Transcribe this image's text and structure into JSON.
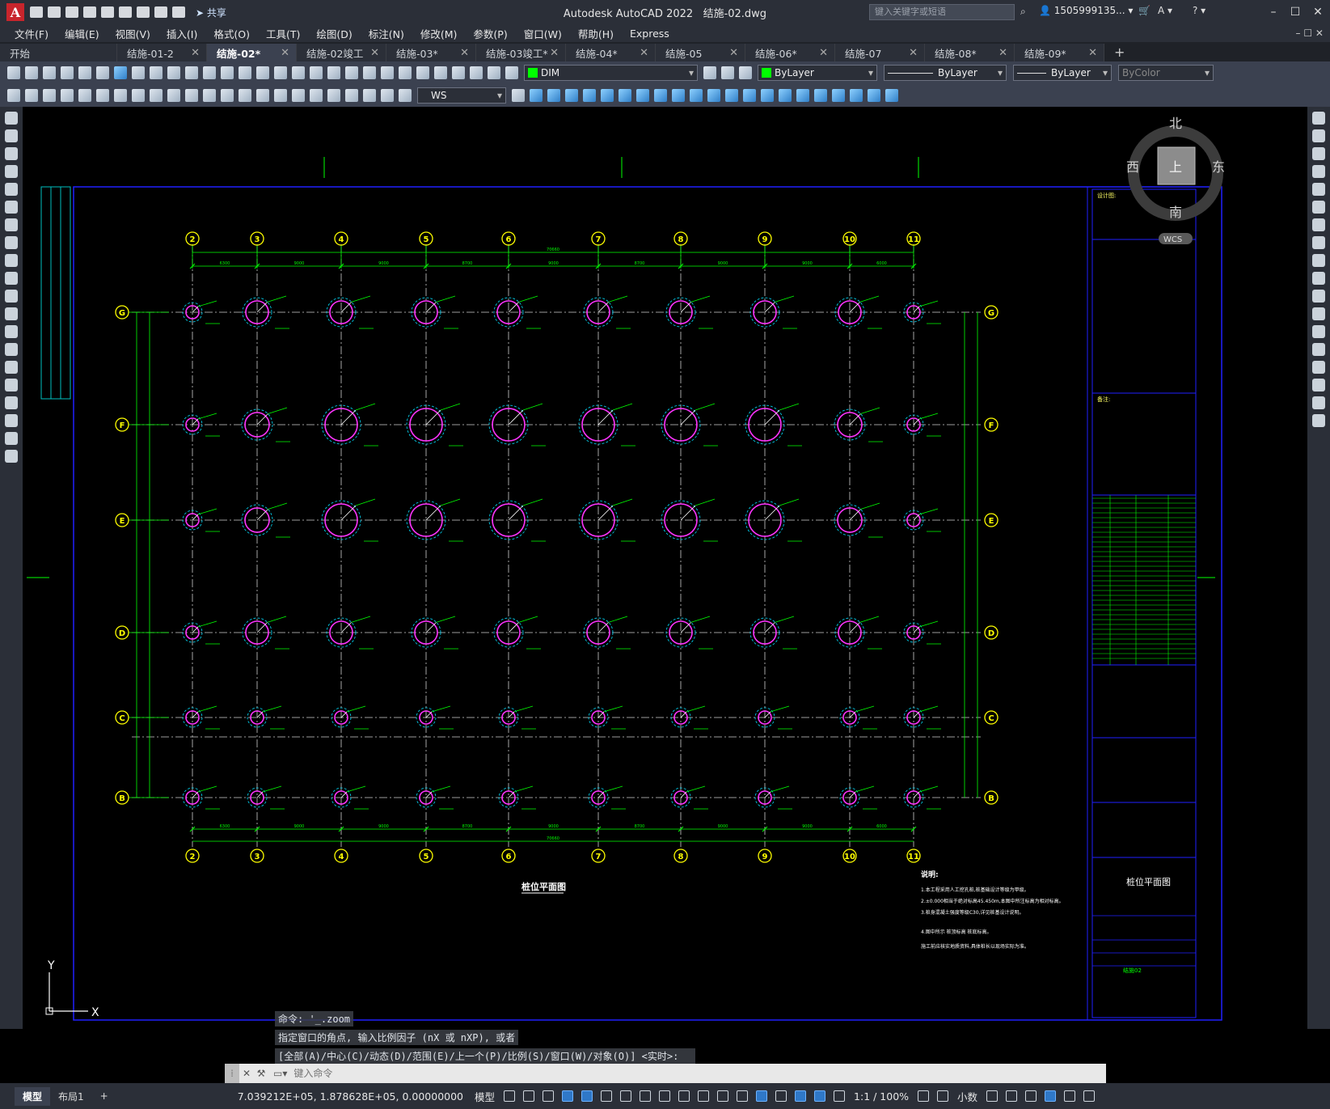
{
  "titlebar": {
    "app_letter": "A",
    "app_title": "Autodesk AutoCAD 2022",
    "file_name": "结施-02.dwg",
    "share_label": "共享",
    "search_placeholder": "键入关键字或短语",
    "user": "1505999135..."
  },
  "menus": [
    "文件(F)",
    "编辑(E)",
    "视图(V)",
    "插入(I)",
    "格式(O)",
    "工具(T)",
    "绘图(D)",
    "标注(N)",
    "修改(M)",
    "参数(P)",
    "窗口(W)",
    "帮助(H)",
    "Express"
  ],
  "tabs": [
    "开始",
    "结施-01-2",
    "结施-02*",
    "结施-02竣工",
    "结施-03*",
    "结施-03竣工*",
    "结施-04*",
    "结施-05",
    "结施-06*",
    "结施-07",
    "结施-08*",
    "结施-09*"
  ],
  "toolbar": {
    "layer": "DIM",
    "layer_color": "#00ff00",
    "color_value": "ByLayer",
    "linetype": "ByLayer",
    "lineweight": "ByLayer",
    "plotstyle": "ByColor",
    "ucs_combo": "WS"
  },
  "viewcube": {
    "north": "北",
    "south": "南",
    "east": "东",
    "west": "西",
    "top": "上",
    "wcs": "WCS"
  },
  "drawing": {
    "col_labels": [
      "2",
      "3",
      "4",
      "5",
      "6",
      "7",
      "8",
      "9",
      "10",
      "11"
    ],
    "row_labels": [
      "G",
      "F",
      "E",
      "D",
      "C",
      "B"
    ],
    "dim_total": "70660",
    "dim_spacings": [
      "6300",
      "9000",
      "9000",
      "8700",
      "9000",
      "8700",
      "9000",
      "9000",
      "6000",
      "6300"
    ],
    "plan_title": "桩位平面图",
    "notes_title": "说明:",
    "notes": [
      "1.本工程采用人工挖孔桩,桩基础设计等级为甲级。",
      "2.±0.000相当于绝对标高45.450m,本图中所注标高为相对标高。",
      "3.桩身混凝土强度等级C30,详见桩基设计说明。",
      "4.图中所示 桩顶标高 桩底标高。",
      "  施工前应核实地质资料,具体桩长以现场实际为准。"
    ],
    "titleblock_sheet": "桩位平面图",
    "titleblock_no": "结施02",
    "side_label_1": "设计图:",
    "side_label_2": "备注:"
  },
  "command": {
    "history": [
      "命令: '_.zoom",
      "指定窗口的角点, 输入比例因子 (nX 或 nXP), 或者",
      "[全部(A)/中心(C)/动态(D)/范围(E)/上一个(P)/比例(S)/窗口(W)/对象(O)] <实时>: _e"
    ],
    "placeholder": "键入命令"
  },
  "status": {
    "tabs": [
      "模型",
      "布局1"
    ],
    "coords": "7.039212E+05, 1.878628E+05, 0.00000000",
    "space": "模型",
    "scale": "1:1 / 100%",
    "units": "小数"
  },
  "ucs": {
    "y": "Y",
    "x": "X"
  }
}
